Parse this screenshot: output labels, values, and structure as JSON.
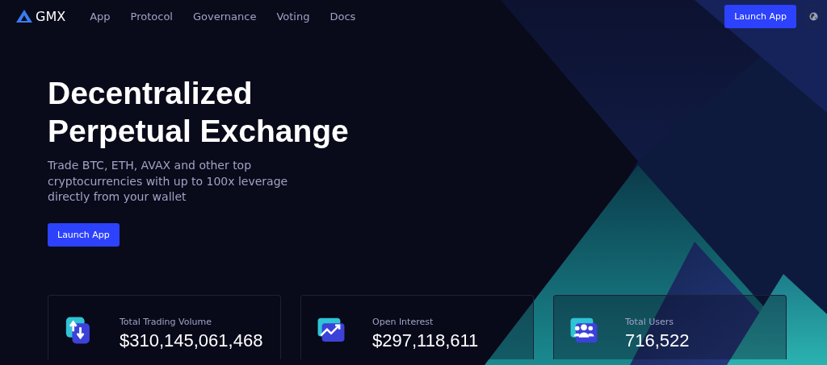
{
  "header": {
    "logo": "GMX",
    "nav": [
      "App",
      "Protocol",
      "Governance",
      "Voting",
      "Docs"
    ],
    "button": "Launch App"
  },
  "hero": {
    "title_lines": [
      "Decentralized",
      "Perpetual Exchange"
    ],
    "subtitle_lines": [
      "Trade BTC, ETH, AVAX and other top",
      "cryptocurrencies with up to 100x leverage",
      "directly from your wallet"
    ],
    "button": "Launch App"
  },
  "stats": [
    {
      "label": "Total Trading Volume",
      "value": "$310,145,061,468"
    },
    {
      "label": "Open Interest",
      "value": "$297,118,611"
    },
    {
      "label": "Total Users",
      "value": "716,522"
    }
  ]
}
